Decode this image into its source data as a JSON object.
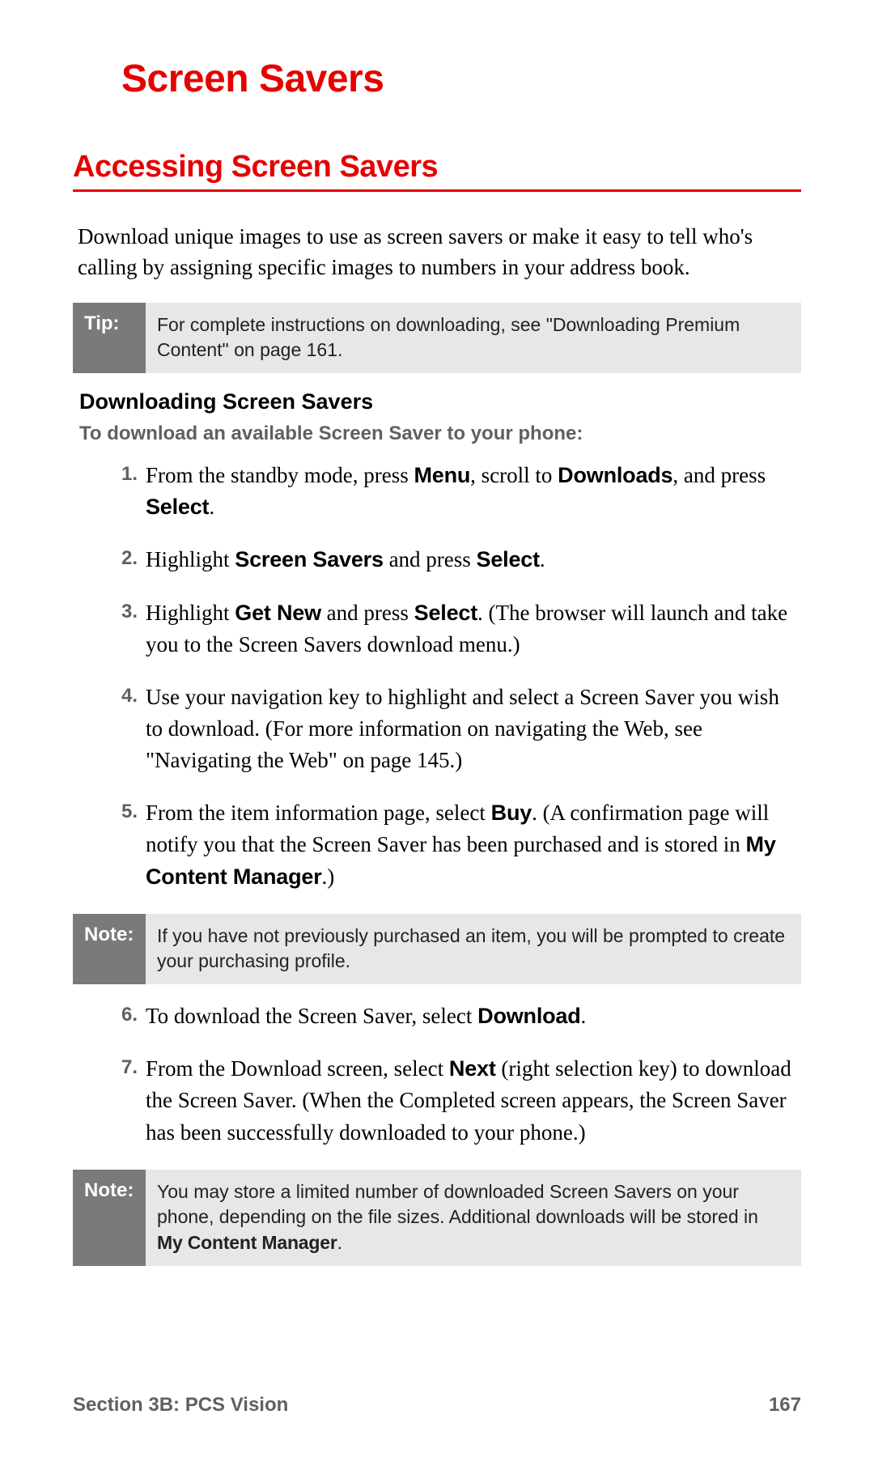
{
  "title": "Screen Savers",
  "section_heading": "Accessing Screen Savers",
  "intro": "Download unique images to use as screen savers or make it easy to tell who's calling by assigning specific images to numbers in your address book.",
  "tip": {
    "label": "Tip:",
    "text": "For complete instructions on downloading, see \"Downloading Premium Content\" on page 161."
  },
  "subhead": "Downloading Screen Savers",
  "leadline": "To download an available Screen Saver to your phone:",
  "steps": [
    {
      "num": "1.",
      "pre": "From the standby mode, press ",
      "b1": "Menu",
      "mid1": ", scroll to ",
      "b2": "Downloads",
      "mid2": ", and press ",
      "b3": "Select",
      "post": "."
    },
    {
      "num": "2.",
      "pre": "Highlight ",
      "b1": "Screen Savers",
      "mid1": " and press ",
      "b2": "Select",
      "post": "."
    },
    {
      "num": "3.",
      "pre": "Highlight ",
      "b1": "Get New",
      "mid1": " and press ",
      "b2": "Select",
      "post": ". (The browser will launch and take you to the Screen Savers download menu.)"
    },
    {
      "num": "4.",
      "pre": "Use your navigation key to highlight and select a Screen Saver you wish to download. (For more information on navigating the Web, see \"Navigating the Web\" on page 145.)"
    },
    {
      "num": "5.",
      "pre": "From the item information page, select ",
      "b1": "Buy",
      "mid1": ". (A confirmation page will notify you that the Screen Saver has been purchased and is stored in ",
      "b2": "My Content Manager",
      "post": ".)"
    }
  ],
  "note1": {
    "label": "Note:",
    "text": "If you have not previously purchased an item, you will be prompted to create your purchasing profile."
  },
  "steps2": [
    {
      "num": "6.",
      "pre": "To download the Screen Saver, select ",
      "b1": "Download",
      "post": "."
    },
    {
      "num": "7.",
      "pre": "From the Download screen, select ",
      "b1": "Next",
      "mid1": " (right selection key) to download the Screen Saver. (When the Completed screen appears, the Screen Saver has been successfully downloaded to your phone.)"
    }
  ],
  "note2": {
    "label": "Note:",
    "pre": "You may store a limited number of downloaded Screen Savers on your phone, depending on the file sizes. Additional downloads will be stored in ",
    "b1": "My Content Manager",
    "post": "."
  },
  "footer": {
    "left_pre": "Section 3B",
    "left_post": ": PCS Vision",
    "right": "167"
  }
}
